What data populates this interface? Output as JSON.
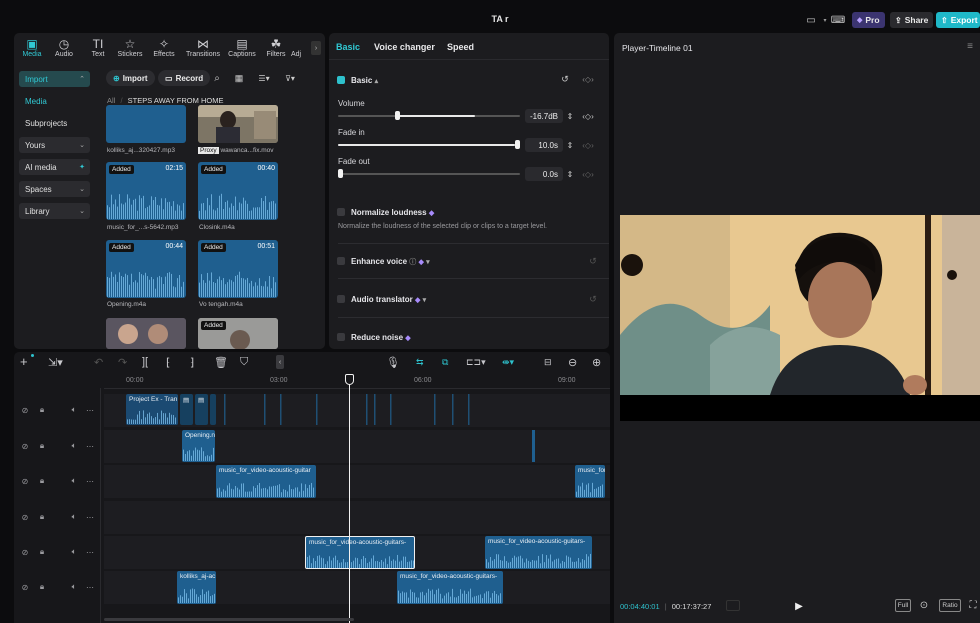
{
  "window": {
    "title": "TA r"
  },
  "header": {
    "pro_label": "Pro",
    "share_label": "Share",
    "export_label": "Export",
    "colors": {
      "pro_bg": "#3b3470",
      "export_bg": "#1fb8c8"
    }
  },
  "top_tabs": [
    {
      "label": "Media",
      "glyph": "▣"
    },
    {
      "label": "Audio",
      "glyph": "◷"
    },
    {
      "label": "Text",
      "glyph": "TI"
    },
    {
      "label": "Stickers",
      "glyph": "☆"
    },
    {
      "label": "Effects",
      "glyph": "✧"
    },
    {
      "label": "Transitions",
      "glyph": "⋈"
    },
    {
      "label": "Captions",
      "glyph": "▤"
    },
    {
      "label": "Filters",
      "glyph": "☘"
    },
    {
      "label": "Adj",
      "glyph": ""
    }
  ],
  "left_nav": {
    "items": [
      {
        "label": "Import",
        "active": true
      },
      {
        "label": "Media"
      },
      {
        "label": "Subprojects"
      },
      {
        "label": "Yours"
      },
      {
        "label": "AI media"
      },
      {
        "label": "Spaces"
      },
      {
        "label": "Library"
      }
    ]
  },
  "media_toolbar": {
    "import_label": "Import",
    "record_label": "Record",
    "breadcrumb_root": "All",
    "breadcrumb_folder": "STEPS AWAY FROM HOME"
  },
  "media_items": [
    {
      "label": "kolliks_aj...320427.mp3",
      "kind": "audio-partial"
    },
    {
      "label": "wawanca...fix.mov",
      "proxy": "Proxy",
      "kind": "video"
    },
    {
      "label": "music_for_...s-5642.mp3",
      "badge": "Added",
      "duration": "02:15",
      "kind": "audio"
    },
    {
      "label": "Closink.m4a",
      "badge": "Added",
      "duration": "00:40",
      "kind": "audio"
    },
    {
      "label": "Opening.m4a",
      "badge": "Added",
      "duration": "00:44",
      "kind": "audio"
    },
    {
      "label": "Vo tengah.m4a",
      "badge": "Added",
      "duration": "00:51",
      "kind": "audio"
    },
    {
      "label": "",
      "kind": "video-partial"
    },
    {
      "label": "",
      "badge": "Added",
      "kind": "video-partial"
    }
  ],
  "properties": {
    "tabs": [
      "Basic",
      "Voice changer",
      "Speed"
    ],
    "section_basic": "Basic",
    "volume_label": "Volume",
    "volume_value": "-16.7dB",
    "volume_level": 0.32,
    "fade_in_label": "Fade in",
    "fade_in_value": "10.0s",
    "fade_in_level": 1.0,
    "fade_out_label": "Fade out",
    "fade_out_value": "0.0s",
    "fade_out_level": 0.0,
    "normalize_title": "Normalize loudness",
    "normalize_desc": "Normalize the loudness of the selected clip or clips to a target level.",
    "enhance_title": "Enhance voice",
    "translator_title": "Audio translator",
    "reduce_title": "Reduce noise",
    "colors": {
      "accent": "#2ec1cc",
      "gem": "#a78bfa"
    }
  },
  "player": {
    "title": "Player-Timeline 01",
    "current_time": "00:04:40:01",
    "total_time": "00:17:37:27",
    "full_label": "Full",
    "ratio_label": "Ratio"
  },
  "timeline": {
    "ruler": [
      "00:00",
      "03:00",
      "06:00",
      "09:00"
    ],
    "tracks": [
      {
        "clips": [
          {
            "name": "Project Ex - Tran",
            "type": "dark"
          },
          {
            "name": "",
            "type": "dark"
          },
          {
            "name": "",
            "type": "dark"
          },
          {
            "name": "",
            "type": "dark"
          }
        ]
      },
      {
        "clips": [
          {
            "name": "Opening.n",
            "type": "blue"
          }
        ]
      },
      {
        "clips": [
          {
            "name": "music_for_video-acoustic-guitar",
            "type": "blue"
          },
          {
            "name": "music_for",
            "type": "blue"
          }
        ]
      },
      {
        "clips": []
      },
      {
        "clips": [
          {
            "name": "music_for_video-acoustic-guitars-",
            "type": "selected"
          },
          {
            "name": "music_for_video-acoustic-guitars-",
            "type": "blue"
          }
        ]
      },
      {
        "clips": [
          {
            "name": "kolliks_aj-ac",
            "type": "blue"
          },
          {
            "name": "music_for_video-acoustic-guitars-",
            "type": "blue"
          }
        ]
      }
    ]
  }
}
